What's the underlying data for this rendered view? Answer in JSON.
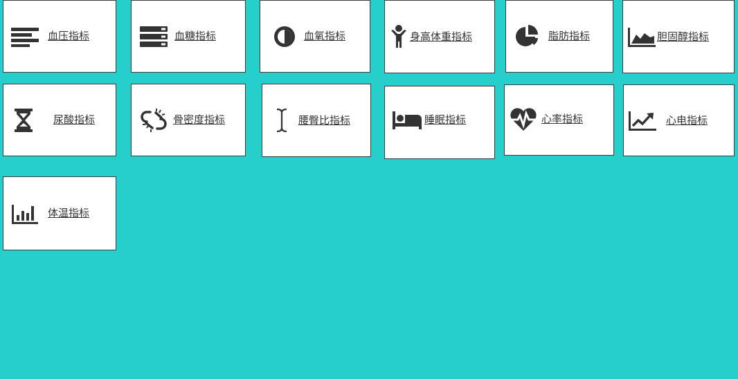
{
  "colors": {
    "background": "#26CFCC",
    "tile_background": "#FFFFFF",
    "tile_border": "#3A3A3A",
    "icon_color": "#333333",
    "text_color": "#333333"
  },
  "tiles": [
    {
      "label": "血压指标",
      "icon": "align-left-icon"
    },
    {
      "label": "血糖指标",
      "icon": "server-icon"
    },
    {
      "label": "血氧指标",
      "icon": "half-circle-icon"
    },
    {
      "label": "身高体重指标",
      "icon": "child-icon"
    },
    {
      "label": "脂肪指标",
      "icon": "pie-chart-icon"
    },
    {
      "label": "胆固醇指标",
      "icon": "area-chart-icon"
    },
    {
      "label": "尿酸指标",
      "icon": "hourglass-icon"
    },
    {
      "label": "骨密度指标",
      "icon": "broken-link-icon"
    },
    {
      "label": "腰臀比指标",
      "icon": "i-cursor-icon"
    },
    {
      "label": "睡眠指标",
      "icon": "bed-icon"
    },
    {
      "label": "心率指标",
      "icon": "heartbeat-icon"
    },
    {
      "label": "心电指标",
      "icon": "line-chart-icon"
    },
    {
      "label": "体温指标",
      "icon": "bar-chart-icon"
    }
  ]
}
